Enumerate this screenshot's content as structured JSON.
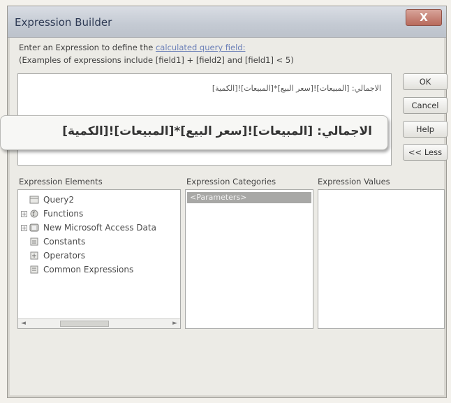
{
  "window": {
    "title": "Expression Builder",
    "close_label": "X"
  },
  "instructions": {
    "line1_prefix": "Enter an Expression to define the ",
    "line1_link": "calculated query field:",
    "line2": "(Examples of expressions include [field1] + [field2] and [field1] < 5)"
  },
  "expression": {
    "value": "الاجمالي: [المبيعات]![سعر البيع]*[المبيعات]![الكمية]",
    "callout": "الاجمالي: [المبيعات]![سعر البيع]*[المبيعات]![الكمية]"
  },
  "buttons": {
    "ok": "OK",
    "cancel": "Cancel",
    "help": "Help",
    "less": "<< Less"
  },
  "elements_panel": {
    "label": "Expression Elements",
    "items": [
      {
        "label": "Query2",
        "expander": "",
        "icon": "query-icon"
      },
      {
        "label": "Functions",
        "expander": "+",
        "icon": "functions-icon"
      },
      {
        "label": "New Microsoft Access Data",
        "expander": "+",
        "icon": "database-icon"
      },
      {
        "label": "Constants",
        "expander": "",
        "icon": "constants-icon"
      },
      {
        "label": "Operators",
        "expander": "",
        "icon": "operators-icon"
      },
      {
        "label": "Common Expressions",
        "expander": "",
        "icon": "common-expressions-icon"
      }
    ],
    "scroll_left": "◄",
    "scroll_right": "►"
  },
  "categories_panel": {
    "label": "Expression Categories",
    "selected": "<Parameters>"
  },
  "values_panel": {
    "label": "Expression Values"
  }
}
